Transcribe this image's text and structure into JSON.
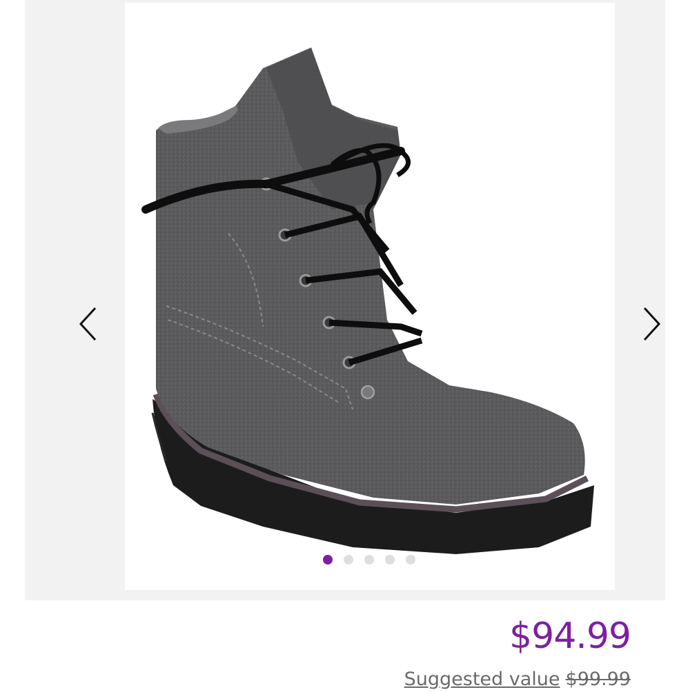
{
  "gallery": {
    "image_alt": "Gray wool lace-up wedge boot",
    "total_images": 5,
    "active_index": 0,
    "prev_icon": "chevron-left-icon",
    "next_icon": "chevron-right-icon",
    "active_dot_color": "#7e1fa3",
    "inactive_dot_color": "#dedede"
  },
  "pricing": {
    "price": "$94.99",
    "suggested_label": "Suggested value",
    "suggested_price": "$99.99",
    "price_color": "#7e1fa3"
  }
}
